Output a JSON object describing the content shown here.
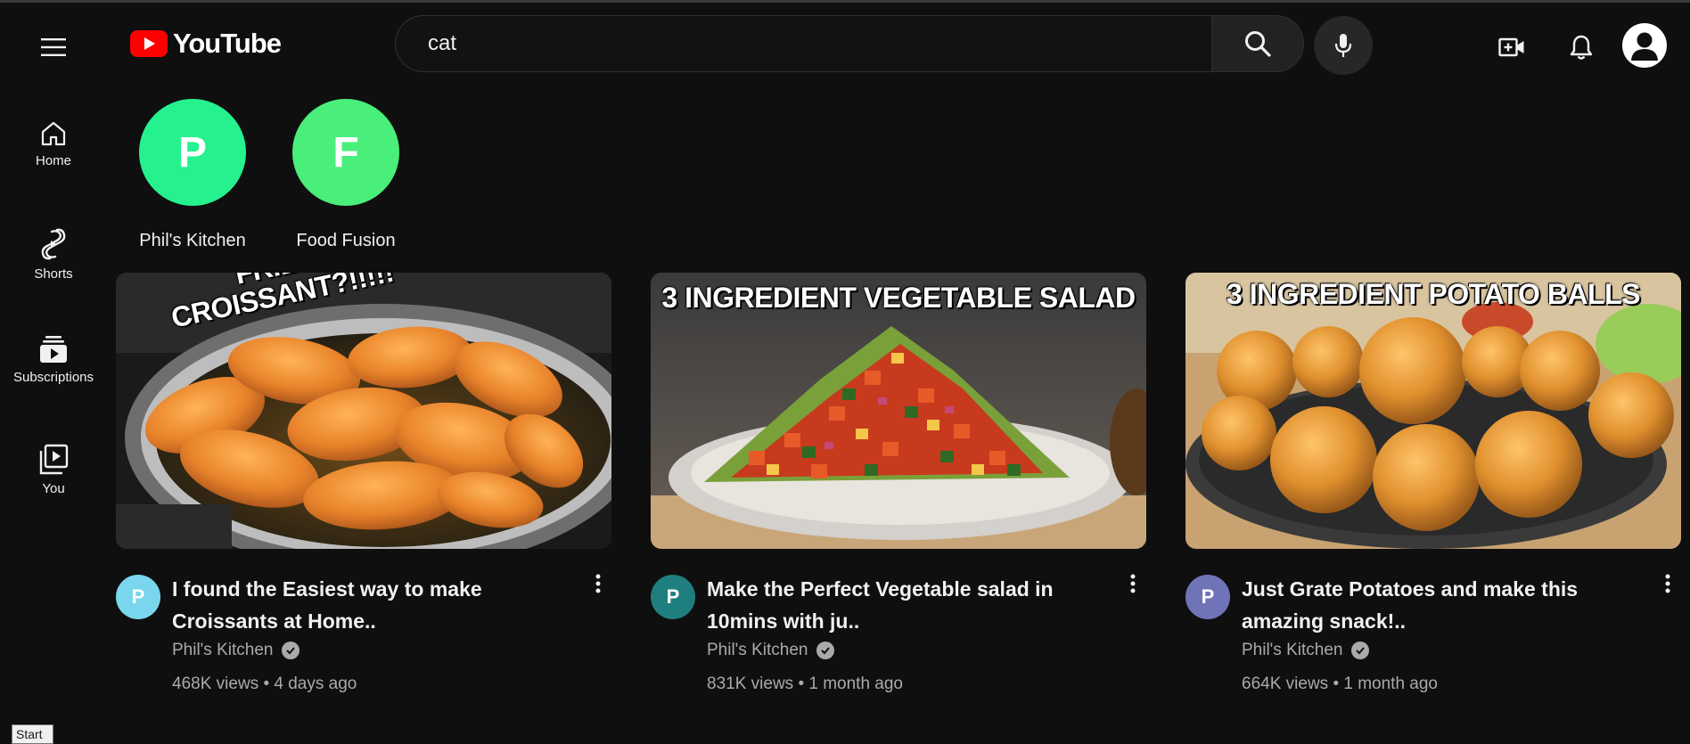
{
  "header": {
    "logo_text": "YouTube",
    "search_value": "cat"
  },
  "sidebar": {
    "items": [
      {
        "label": "Home",
        "icon": "home-icon"
      },
      {
        "label": "Shorts",
        "icon": "shorts-icon"
      },
      {
        "label": "Subscriptions",
        "icon": "subscriptions-icon"
      },
      {
        "label": "You",
        "icon": "you-icon"
      }
    ]
  },
  "channels": [
    {
      "initial": "P",
      "name": "Phil's Kitchen",
      "color": "#25f28f"
    },
    {
      "initial": "F",
      "name": "Food Fusion",
      "color": "#4aee7a"
    }
  ],
  "videos": [
    {
      "thumb_text_line1": "FRIED",
      "thumb_text_line2": "CROISSANT?!!!!!",
      "avatar_initial": "P",
      "avatar_color": "#7ad6ec",
      "title": "I found the Easiest way to make Croissants at Home..",
      "channel": "Phil's Kitchen",
      "stats": "468K views • 4 days ago"
    },
    {
      "thumb_text": "3 INGREDIENT VEGETABLE SALAD",
      "avatar_initial": "P",
      "avatar_color": "#1f7f7e",
      "title": "Make the Perfect Vegetable salad in 10mins with ju..",
      "channel": "Phil's Kitchen",
      "stats": "831K views • 1 month ago"
    },
    {
      "thumb_text": "3 INGREDIENT POTATO BALLS",
      "avatar_initial": "P",
      "avatar_color": "#6f74b8",
      "title": "Just Grate Potatoes and make this amazing snack!..",
      "channel": "Phil's Kitchen",
      "stats": "664K views • 1 month ago"
    }
  ],
  "taskbar": {
    "start_tooltip": "Start"
  },
  "colors": {
    "background": "#0f0f0f",
    "brand_red": "#ff0000",
    "text_secondary": "#aaaaaa"
  }
}
